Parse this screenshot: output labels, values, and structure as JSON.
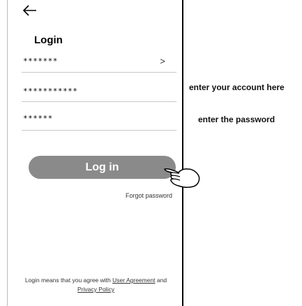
{
  "header": {
    "back_icon": "back-arrow-icon",
    "title": "Login"
  },
  "form": {
    "account_value": "*******",
    "account_chevron": ">",
    "account_entry_value": "***********",
    "password_value": "******"
  },
  "actions": {
    "login_label": "Log in",
    "forgot_label": "Forgot password"
  },
  "footer": {
    "prefix": "Login means that you agree with ",
    "user_agreement": "User Agreement",
    "and": " and",
    "privacy_policy": "Privacy Policy"
  },
  "annotations": {
    "account_hint": "enter your account here",
    "password_hint": "enter the password",
    "pointer_icon": "pointing-hand-icon"
  },
  "colors": {
    "button": "#8a8a8a",
    "divider": "#c8c8c8"
  }
}
